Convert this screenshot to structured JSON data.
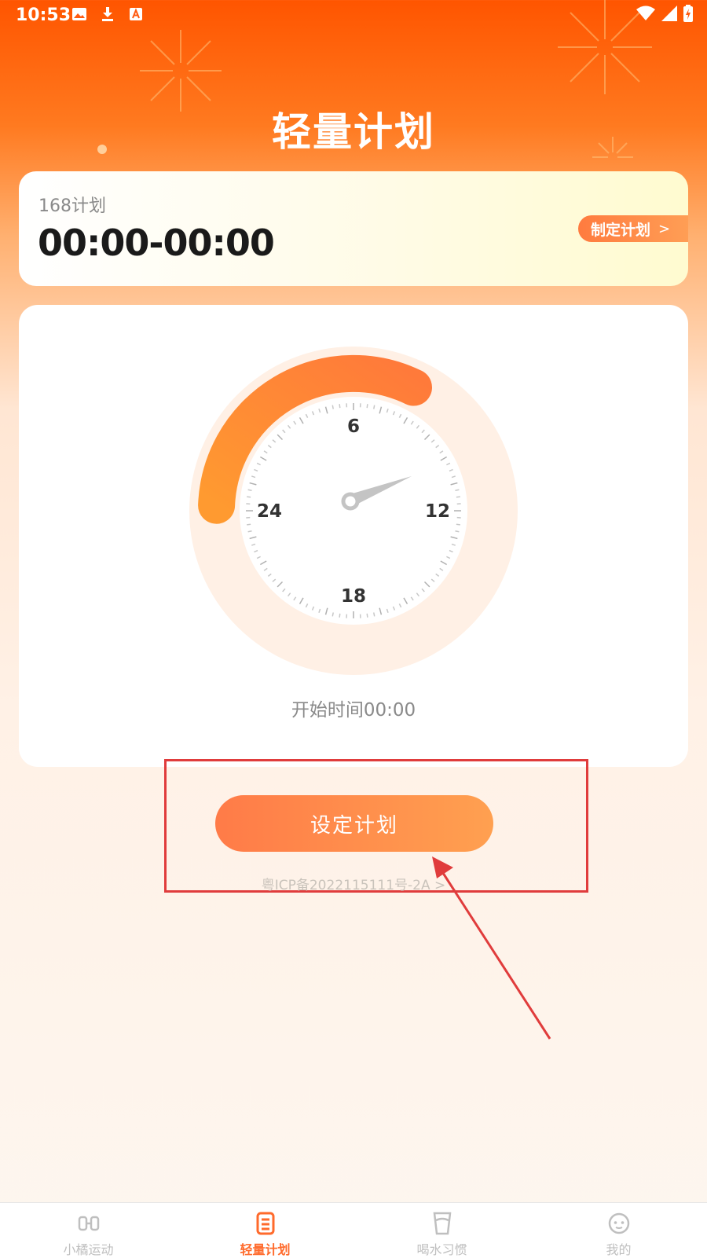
{
  "status_bar": {
    "time": "10:53",
    "icons": [
      "image-icon",
      "download-icon",
      "a-icon"
    ],
    "right_icons": [
      "wifi-icon",
      "signal-icon",
      "battery-icon"
    ]
  },
  "header": {
    "title": "轻量计划"
  },
  "plan_card": {
    "name": "168计划",
    "time_range": "00:00-00:00",
    "make_plan_label": "制定计划"
  },
  "clock": {
    "labels": {
      "top": "6",
      "right": "12",
      "bottom": "18",
      "left": "24"
    },
    "start_time_text": "开始时间00:00"
  },
  "set_plan_button": {
    "label": "设定计划"
  },
  "icp_text": "粤ICP备2022115111号-2A >",
  "tabs": [
    {
      "label": "小橘运动",
      "icon": "sport-icon",
      "active": false
    },
    {
      "label": "轻量计划",
      "icon": "plan-icon",
      "active": true
    },
    {
      "label": "喝水习惯",
      "icon": "water-cup-icon",
      "active": false
    },
    {
      "label": "我的",
      "icon": "profile-icon",
      "active": false
    }
  ],
  "colors": {
    "accent": "#ff6a2b",
    "header_top": "#ff5500",
    "annotation": "#e03c3c"
  }
}
